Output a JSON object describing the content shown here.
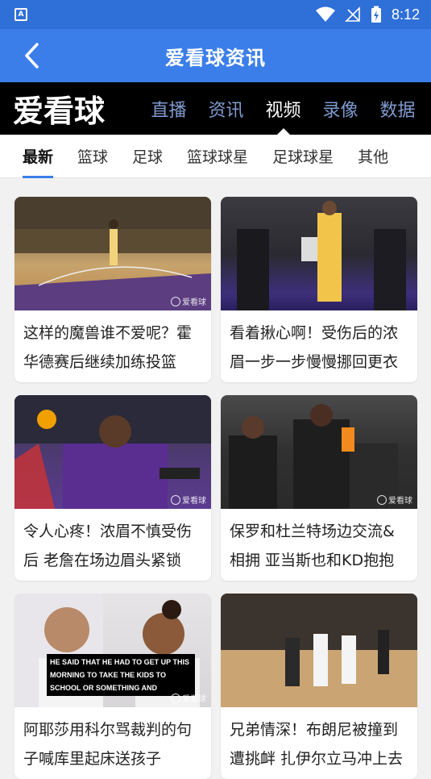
{
  "status": {
    "time": "8:12",
    "badge": "A"
  },
  "appbar": {
    "title": "爱看球资讯"
  },
  "brand": {
    "logo": "爱看球",
    "tabs": [
      {
        "label": "直播",
        "active": false
      },
      {
        "label": "资讯",
        "active": false
      },
      {
        "label": "视频",
        "active": true
      },
      {
        "label": "录像",
        "active": false
      },
      {
        "label": "数据",
        "active": false
      }
    ]
  },
  "categories": [
    "最新",
    "篮球",
    "足球",
    "篮球球星",
    "足球球星",
    "其他"
  ],
  "cards": [
    {
      "title": "这样的魔兽谁不爱呢？霍华德赛后继续加练投篮",
      "watermark": "爱看球",
      "caption": ""
    },
    {
      "title": "看着揪心啊！受伤后的浓眉一步一步慢慢挪回更衣室",
      "watermark": "",
      "caption": ""
    },
    {
      "title": "令人心疼！浓眉不慎受伤后 老詹在场边眉头紧锁",
      "watermark": "爱看球",
      "caption": ""
    },
    {
      "title": "保罗和杜兰特场边交流&相拥 亚当斯也和KD抱抱",
      "watermark": "爱看球",
      "caption": ""
    },
    {
      "title": "阿耶莎用科尔骂裁判的句子喊库里起床送孩子",
      "watermark": "爱看球",
      "caption": "HE SAID THAT HE HAD TO GET UP THIS MORNING TO TAKE THE KIDS TO SCHOOL OR SOMETHING AND"
    },
    {
      "title": "兄弟情深！布朗尼被撞到遭挑衅 扎伊尔立马冲上去",
      "watermark": "",
      "caption": ""
    }
  ],
  "colors": {
    "primary": "#3b7ee9",
    "statusbar": "#2f6fd8"
  }
}
